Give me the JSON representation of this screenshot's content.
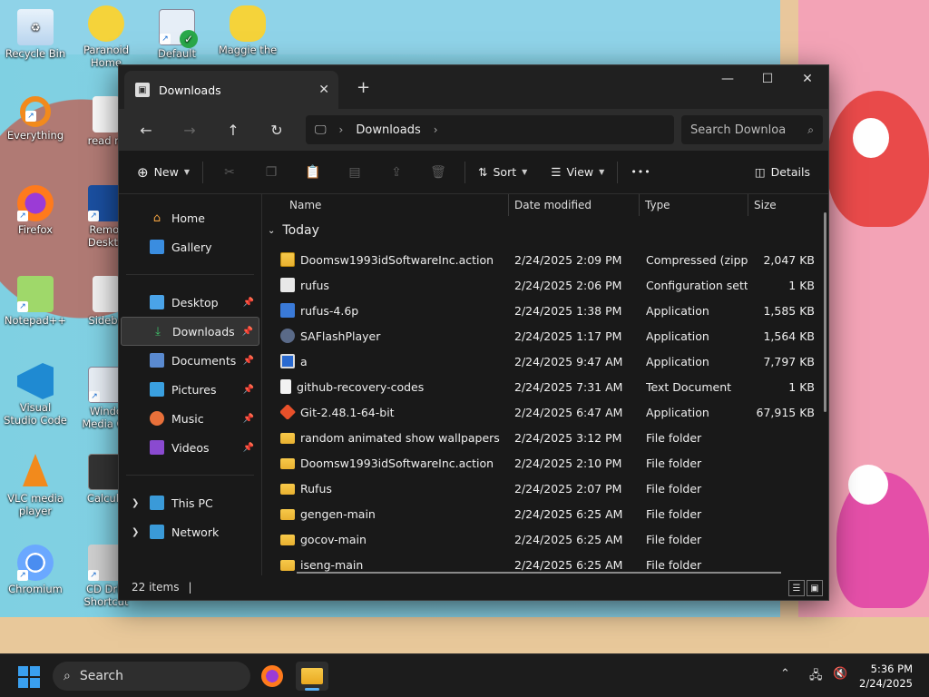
{
  "desktop": {
    "icons": [
      {
        "label": "Recycle Bin"
      },
      {
        "label": "Paranoid Home"
      },
      {
        "label": "Default"
      },
      {
        "label": "Maggie the"
      },
      {
        "label": "Everything"
      },
      {
        "label": "read m"
      },
      {
        "label": "Firefox"
      },
      {
        "label": "Remot Deskto"
      },
      {
        "label": "Notepad++"
      },
      {
        "label": "Sideba"
      },
      {
        "label": "Visual Studio Code"
      },
      {
        "label": "Windo Media Ce"
      },
      {
        "label": "VLC media player"
      },
      {
        "label": "Calcula"
      },
      {
        "label": "Chromium"
      },
      {
        "label": "CD Driv Shortcut"
      }
    ]
  },
  "window": {
    "tab_title": "Downloads",
    "new_tab": "+",
    "address": {
      "segment": "Downloads"
    },
    "search_placeholder": "Search Downloa",
    "toolbar": {
      "new": "New",
      "sort": "Sort",
      "view": "View",
      "more": "•••",
      "details": "Details"
    },
    "nav": {
      "quick": [
        {
          "label": "Home"
        },
        {
          "label": "Gallery"
        }
      ],
      "pinned": [
        {
          "label": "Desktop"
        },
        {
          "label": "Downloads"
        },
        {
          "label": "Documents"
        },
        {
          "label": "Pictures"
        },
        {
          "label": "Music"
        },
        {
          "label": "Videos"
        }
      ],
      "tree": [
        {
          "label": "This PC"
        },
        {
          "label": "Network"
        }
      ]
    },
    "columns": {
      "name": "Name",
      "date": "Date modified",
      "type": "Type",
      "size": "Size"
    },
    "group": "Today",
    "files": [
      {
        "name": "Doomsw1993idSoftwareInc.action",
        "date": "2/24/2025 2:09 PM",
        "type": "Compressed (zipp...",
        "size": "2,047 KB",
        "icon": "zip-folder-icon"
      },
      {
        "name": "rufus",
        "date": "2/24/2025 2:06 PM",
        "type": "Configuration sett...",
        "size": "1 KB",
        "icon": "config-file-icon"
      },
      {
        "name": "rufus-4.6p",
        "date": "2/24/2025 1:38 PM",
        "type": "Application",
        "size": "1,585 KB",
        "icon": "usb-app-icon"
      },
      {
        "name": "SAFlashPlayer",
        "date": "2/24/2025 1:17 PM",
        "type": "Application",
        "size": "1,564 KB",
        "icon": "flash-app-icon"
      },
      {
        "name": "a",
        "date": "2/24/2025 9:47 AM",
        "type": "Application",
        "size": "7,797 KB",
        "icon": "app-icon"
      },
      {
        "name": "github-recovery-codes",
        "date": "2/24/2025 7:31 AM",
        "type": "Text Document",
        "size": "1 KB",
        "icon": "text-file-icon"
      },
      {
        "name": "Git-2.48.1-64-bit",
        "date": "2/24/2025 6:47 AM",
        "type": "Application",
        "size": "67,915 KB",
        "icon": "git-app-icon"
      },
      {
        "name": "random animated show wallpapers",
        "date": "2/24/2025 3:12 PM",
        "type": "File folder",
        "size": "",
        "icon": "folder-icon"
      },
      {
        "name": "Doomsw1993idSoftwareInc.action",
        "date": "2/24/2025 2:10 PM",
        "type": "File folder",
        "size": "",
        "icon": "folder-icon"
      },
      {
        "name": "Rufus",
        "date": "2/24/2025 2:07 PM",
        "type": "File folder",
        "size": "",
        "icon": "folder-icon"
      },
      {
        "name": "gengen-main",
        "date": "2/24/2025 6:25 AM",
        "type": "File folder",
        "size": "",
        "icon": "folder-icon"
      },
      {
        "name": "gocov-main",
        "date": "2/24/2025 6:25 AM",
        "type": "File folder",
        "size": "",
        "icon": "folder-icon"
      },
      {
        "name": "iseng-main",
        "date": "2/24/2025 6:25 AM",
        "type": "File folder",
        "size": "",
        "icon": "folder-icon"
      }
    ],
    "status": {
      "count": "22 items",
      "cursor": "|"
    }
  },
  "taskbar": {
    "search": "Search",
    "time": "5:36 PM",
    "date": "2/24/2025"
  }
}
